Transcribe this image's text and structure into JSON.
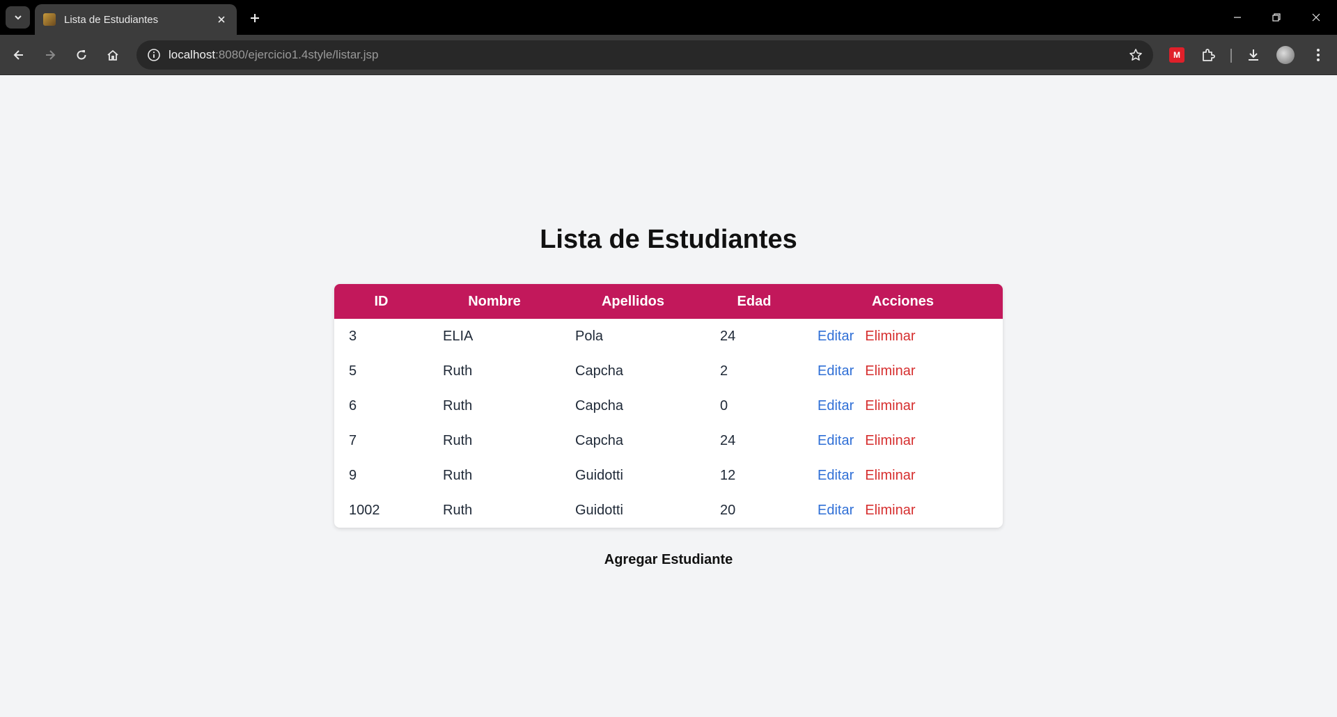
{
  "browser": {
    "tab_title": "Lista de Estudiantes",
    "url_host": "localhost",
    "url_path": ":8080/ejercicio1.4style/listar.jsp",
    "extension_label": "M"
  },
  "page": {
    "title": "Lista de Estudiantes",
    "table": {
      "headers": {
        "id": "ID",
        "nombre": "Nombre",
        "apellidos": "Apellidos",
        "edad": "Edad",
        "acciones": "Acciones"
      },
      "rows": [
        {
          "id": "3",
          "nombre": "ELIA",
          "apellidos": "Pola",
          "edad": "24",
          "edit": "Editar",
          "delete": "Eliminar"
        },
        {
          "id": "5",
          "nombre": "Ruth",
          "apellidos": "Capcha",
          "edad": "2",
          "edit": "Editar",
          "delete": "Eliminar"
        },
        {
          "id": "6",
          "nombre": "Ruth",
          "apellidos": "Capcha",
          "edad": "0",
          "edit": "Editar",
          "delete": "Eliminar"
        },
        {
          "id": "7",
          "nombre": "Ruth",
          "apellidos": "Capcha",
          "edad": "24",
          "edit": "Editar",
          "delete": "Eliminar"
        },
        {
          "id": "9",
          "nombre": "Ruth",
          "apellidos": "Guidotti",
          "edad": "12",
          "edit": "Editar",
          "delete": "Eliminar"
        },
        {
          "id": "1002",
          "nombre": "Ruth",
          "apellidos": "Guidotti",
          "edad": "20",
          "edit": "Editar",
          "delete": "Eliminar"
        }
      ]
    },
    "add_button": "Agregar Estudiante"
  },
  "colors": {
    "header_bg": "#c2185b",
    "edit_link": "#2f6fd6",
    "delete_link": "#d62f2f",
    "page_bg": "#f3f4f6"
  }
}
